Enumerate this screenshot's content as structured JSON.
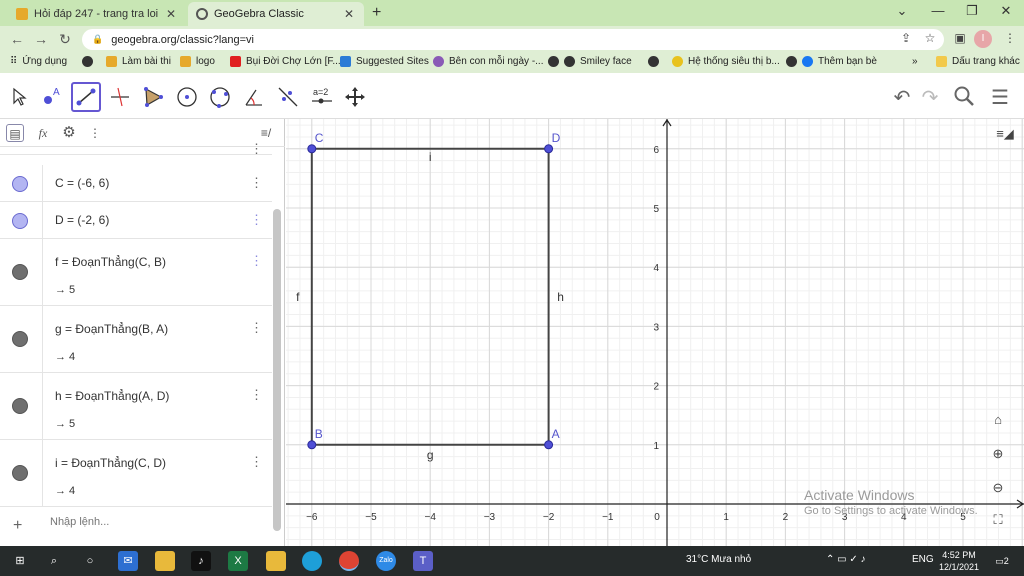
{
  "browser": {
    "tabs": [
      {
        "title": "Hỏi đáp 247 - trang tra loi",
        "active": false
      },
      {
        "title": "GeoGebra Classic",
        "active": true
      }
    ],
    "url": "geogebra.org/classic?lang=vi",
    "profile_initial": "I",
    "bookmarks": [
      "Ứng dụng",
      "Làm bài thi",
      "logo",
      "Bụi Đời Chợ Lớn [F...",
      "Suggested Sites",
      "Bên con mỗi ngày -...",
      "Smiley face",
      "Hệ thống siêu thị b...",
      "Thêm bạn bè",
      "Dấu trang khác"
    ]
  },
  "toolbar": {
    "tools": [
      "move-tool",
      "point-tool",
      "segment-tool",
      "perpendicular-tool",
      "polygon-tool",
      "circle-tool",
      "circle-three-points-tool",
      "angle-tool",
      "reflect-tool",
      "slider-tool",
      "move-graphics-tool"
    ],
    "selected": "segment-tool",
    "slider_label": "a=2"
  },
  "algebra": {
    "items": [
      {
        "def": "C = (-6, 6)",
        "kind": "point"
      },
      {
        "def": "D = (-2, 6)",
        "kind": "point"
      },
      {
        "def": "f = ĐoạnThẳng(C, B)",
        "value": "→ 5",
        "kind": "segment"
      },
      {
        "def": "g = ĐoạnThẳng(B, A)",
        "value": "→ 4",
        "kind": "segment"
      },
      {
        "def": "h = ĐoạnThẳng(A, D)",
        "value": "→ 5",
        "kind": "segment"
      },
      {
        "def": "i = ĐoạnThẳng(C, D)",
        "value": "→ 4",
        "kind": "segment"
      }
    ],
    "input_placeholder": "Nhập lệnh..."
  },
  "graphics": {
    "points": [
      {
        "name": "A",
        "x": -2,
        "y": 1
      },
      {
        "name": "B",
        "x": -6,
        "y": 1
      },
      {
        "name": "C",
        "x": -6,
        "y": 6
      },
      {
        "name": "D",
        "x": -2,
        "y": 6
      }
    ],
    "segments": [
      {
        "name": "f",
        "from": "C",
        "to": "B"
      },
      {
        "name": "g",
        "from": "B",
        "to": "A"
      },
      {
        "name": "h",
        "from": "A",
        "to": "D"
      },
      {
        "name": "i",
        "from": "C",
        "to": "D"
      }
    ],
    "x_ticks": [
      "−6",
      "−5",
      "−4",
      "−3",
      "−2",
      "−1",
      "0",
      "1",
      "2",
      "3",
      "4",
      "5"
    ],
    "y_ticks": [
      "1",
      "2",
      "3",
      "4",
      "5",
      "6"
    ],
    "colors": {
      "point_fill": "#4f4fd6",
      "segment": "#444444",
      "grid_major": "#d8d8d8",
      "grid_minor": "#f0f0f0",
      "label": "#5555cc"
    }
  },
  "watermark": {
    "line1": "Activate Windows",
    "line2": "Go to Settings to activate Windows."
  },
  "taskbar": {
    "weather": "31°C  Mưa nhỏ",
    "lang": "ENG",
    "time": "4:52 PM",
    "date": "12/1/2021",
    "notifications": "2"
  }
}
